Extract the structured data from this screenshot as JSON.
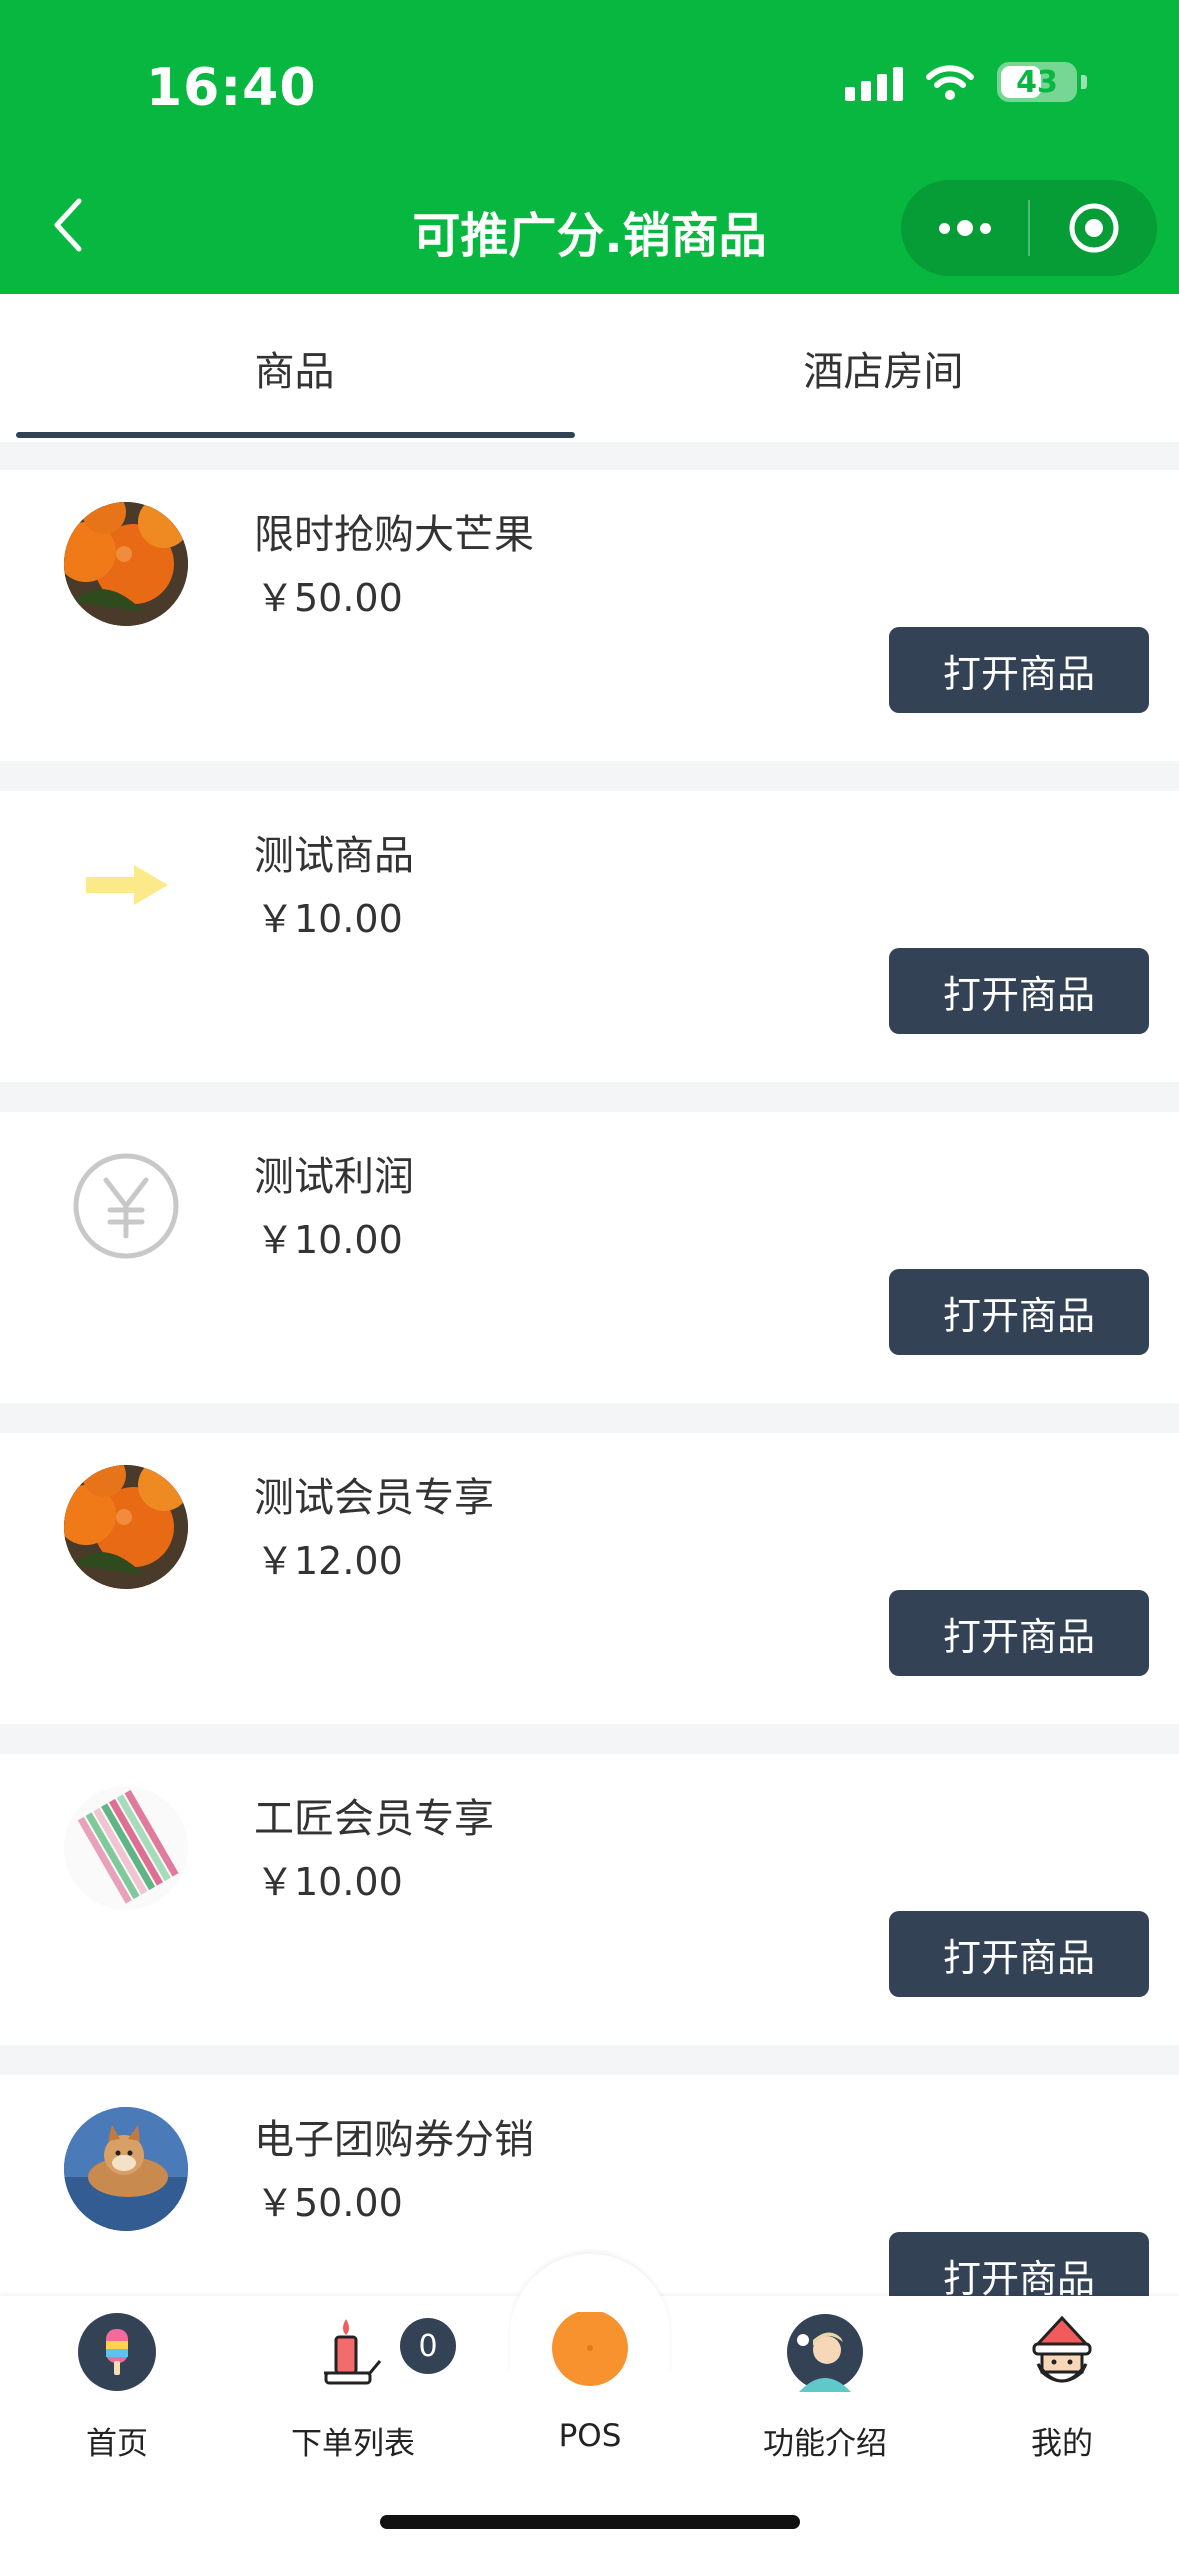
{
  "status_bar": {
    "time": "16:40",
    "battery": "43"
  },
  "nav": {
    "title": "可推广分.销商品"
  },
  "tabs": [
    {
      "label": "商品",
      "active": true
    },
    {
      "label": "酒店房间",
      "active": false
    }
  ],
  "products": [
    {
      "name": "限时抢购大芒果",
      "price": "￥50.00",
      "button": "打开商品",
      "icon": "oranges-photo"
    },
    {
      "name": "测试商品",
      "price": "￥10.00",
      "button": "打开商品",
      "icon": "arrow-right-icon"
    },
    {
      "name": "测试利润",
      "price": "￥10.00",
      "button": "打开商品",
      "icon": "yen-icon"
    },
    {
      "name": "测试会员专享",
      "price": "￥12.00",
      "button": "打开商品",
      "icon": "oranges-photo"
    },
    {
      "name": "工匠会员专享",
      "price": "￥10.00",
      "button": "打开商品",
      "icon": "pencils-photo"
    },
    {
      "name": "电子团购券分销",
      "price": "￥50.00",
      "button": "打开商品",
      "icon": "dog-photo"
    }
  ],
  "tabbar": {
    "items": [
      {
        "label": "首页",
        "icon": "popsicle-icon"
      },
      {
        "label": "下单列表",
        "icon": "candle-icon",
        "badge": "0"
      },
      {
        "label": "POS",
        "icon": "orange-dot-icon"
      },
      {
        "label": "功能介绍",
        "icon": "person-avatar-icon"
      },
      {
        "label": "我的",
        "icon": "santa-icon"
      }
    ]
  },
  "colors": {
    "brand_green": "#07b73f",
    "button_navy": "#344256"
  }
}
